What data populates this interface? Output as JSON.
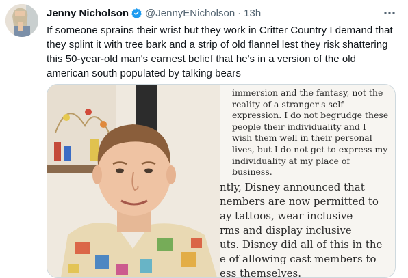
{
  "tweet": {
    "author_name": "Jenny Nicholson",
    "author_handle": "@JennyENicholson",
    "separator": "·",
    "timestamp": "13h",
    "text": "If someone sprains their wrist but they work in Critter Country I demand that they splint it with tree bark and a strip of old flannel lest they risk shattering this 50-year-old man's earnest belief that he's in a version of the old american south populated by talking bears"
  },
  "media": {
    "document_quote_lines": [
      "immersion and the fantasy, not the",
      "reality of a stranger's self-",
      "expression. I do not begrudge these",
      "people their individuality and I",
      "wish them well in their personal",
      "lives, but I do not get to express my",
      "individuality at my place of",
      "business."
    ],
    "document_para_lines": [
      "ntly, Disney announced that",
      "nembers are now permitted to",
      "ay tattoos, wear inclusive",
      "rms and display inclusive",
      "uts. Disney did all of this in the",
      "e of allowing cast members to",
      "ess themselves."
    ]
  },
  "icons": {
    "verified": "verified-badge-icon",
    "more": "more-options-icon"
  },
  "colors": {
    "verified_blue": "#1d9bf0",
    "secondary_text": "#536471",
    "border": "#cfd9de"
  }
}
